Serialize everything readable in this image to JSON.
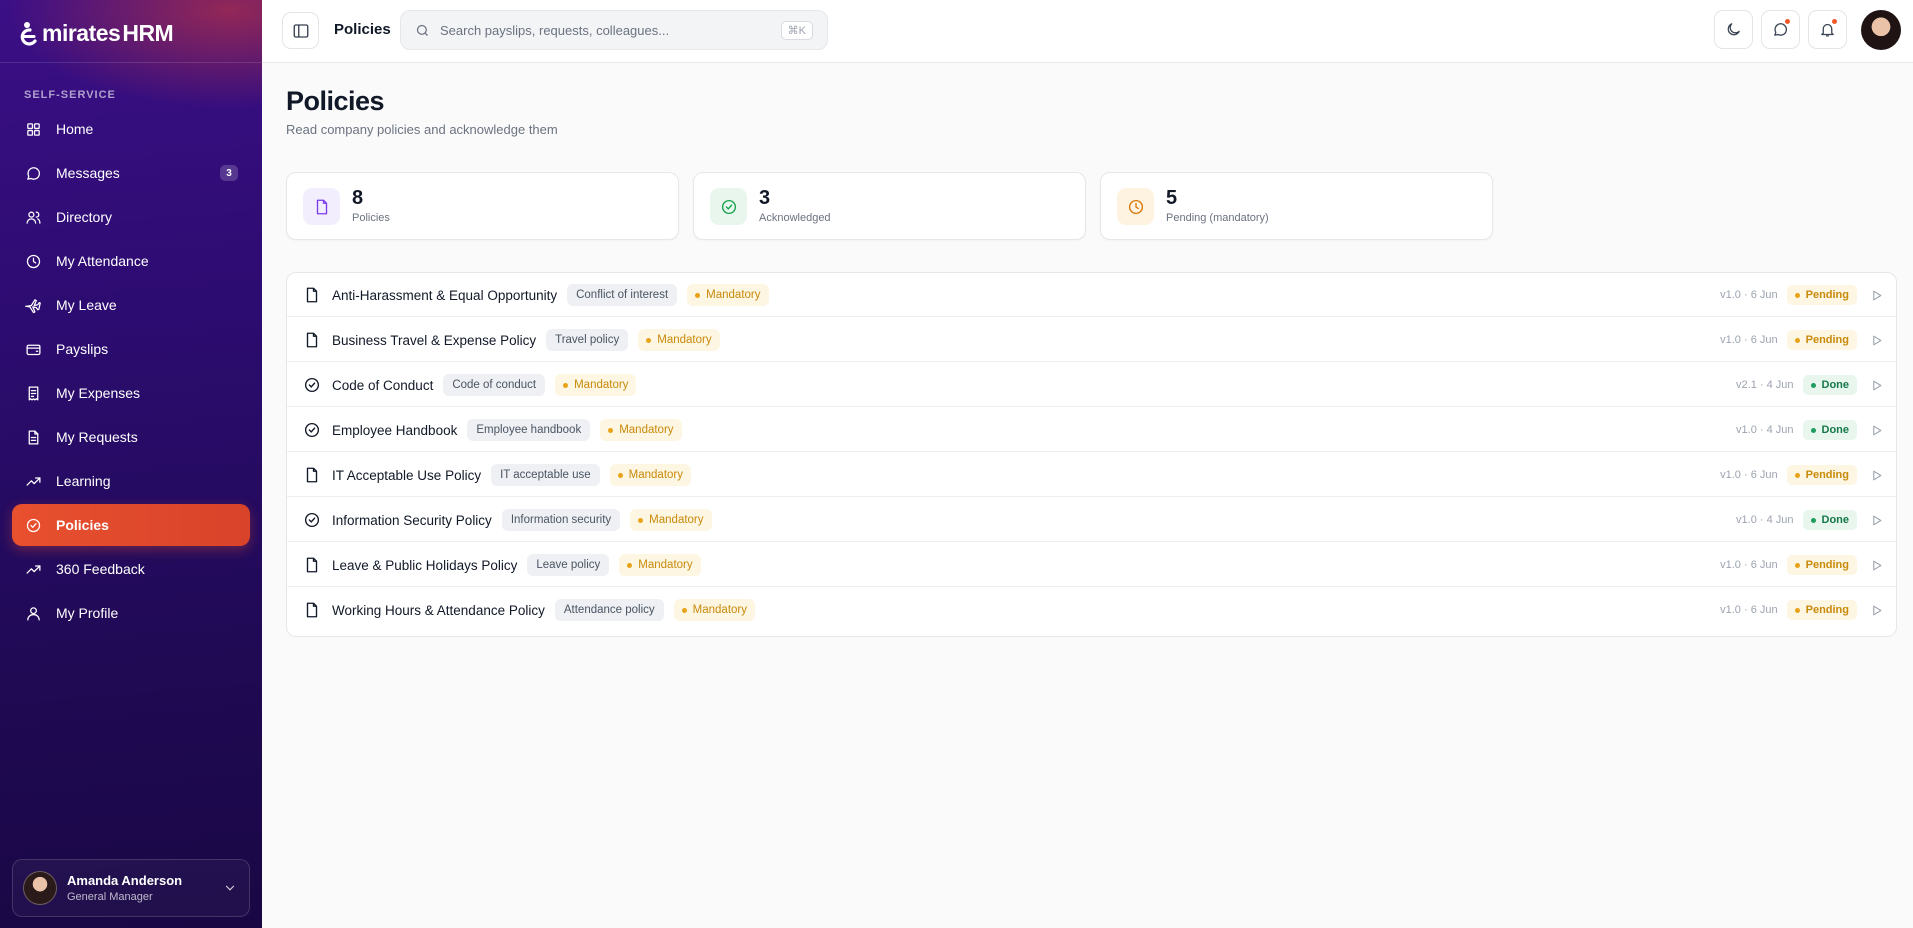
{
  "brand": {
    "name": "mirates HRM",
    "logo_text": "mirates",
    "logo_suffix": "HRM"
  },
  "sidebar": {
    "section_label": "SELF-SERVICE",
    "items": [
      {
        "label": "Home",
        "icon": "grid-icon"
      },
      {
        "label": "Messages",
        "icon": "message-icon",
        "badge": "3"
      },
      {
        "label": "Directory",
        "icon": "users-icon"
      },
      {
        "label": "My Attendance",
        "icon": "clock-icon"
      },
      {
        "label": "My Leave",
        "icon": "plane-icon"
      },
      {
        "label": "Payslips",
        "icon": "wallet-icon"
      },
      {
        "label": "My Expenses",
        "icon": "receipt-icon"
      },
      {
        "label": "My Requests",
        "icon": "document-icon"
      },
      {
        "label": "Learning",
        "icon": "trend-icon"
      },
      {
        "label": "Policies",
        "icon": "check-circle-icon",
        "active": true
      },
      {
        "label": "360 Feedback",
        "icon": "trend-icon"
      },
      {
        "label": "My Profile",
        "icon": "user-icon"
      }
    ],
    "user": {
      "name": "Amanda Anderson",
      "role": "General Manager"
    }
  },
  "topbar": {
    "title": "Policies",
    "search_placeholder": "Search payslips, requests, colleagues...",
    "shortcut": "⌘K"
  },
  "page": {
    "title": "Policies",
    "subtitle": "Read company policies and acknowledge them"
  },
  "stats": [
    {
      "value": "8",
      "label": "Policies",
      "color": "#7c3aed"
    },
    {
      "value": "3",
      "label": "Acknowledged",
      "color": "#16a34a"
    },
    {
      "value": "5",
      "label": "Pending (mandatory)",
      "color": "#d97706"
    }
  ],
  "policies": [
    {
      "title": "Anti-Harassment & Equal Opportunity",
      "category": "Conflict of interest",
      "tag": "Mandatory",
      "version": "v1.0 · 6 Jun",
      "status": "Pending",
      "acknowledged": false
    },
    {
      "title": "Business Travel & Expense Policy",
      "category": "Travel policy",
      "tag": "Mandatory",
      "version": "v1.0 · 6 Jun",
      "status": "Pending",
      "acknowledged": false
    },
    {
      "title": "Code of Conduct",
      "category": "Code of conduct",
      "tag": "Mandatory",
      "version": "v2.1 · 4 Jun",
      "status": "Done",
      "acknowledged": true
    },
    {
      "title": "Employee Handbook",
      "category": "Employee handbook",
      "tag": "Mandatory",
      "version": "v1.0 · 4 Jun",
      "status": "Done",
      "acknowledged": true
    },
    {
      "title": "IT Acceptable Use Policy",
      "category": "IT acceptable use",
      "tag": "Mandatory",
      "version": "v1.0 · 6 Jun",
      "status": "Pending",
      "acknowledged": false
    },
    {
      "title": "Information Security Policy",
      "category": "Information security",
      "tag": "Mandatory",
      "version": "v1.0 · 4 Jun",
      "status": "Done",
      "acknowledged": true
    },
    {
      "title": "Leave & Public Holidays Policy",
      "category": "Leave policy",
      "tag": "Mandatory",
      "version": "v1.0 · 6 Jun",
      "status": "Pending",
      "acknowledged": false
    },
    {
      "title": "Working Hours & Attendance Policy",
      "category": "Attendance policy",
      "tag": "Mandatory",
      "version": "v1.0 · 6 Jun",
      "status": "Pending",
      "acknowledged": false
    }
  ],
  "colors": {
    "accent": "#e8502e",
    "sidebar": "#2c0c70",
    "pending": "#c98a0a",
    "done": "#16794a"
  }
}
